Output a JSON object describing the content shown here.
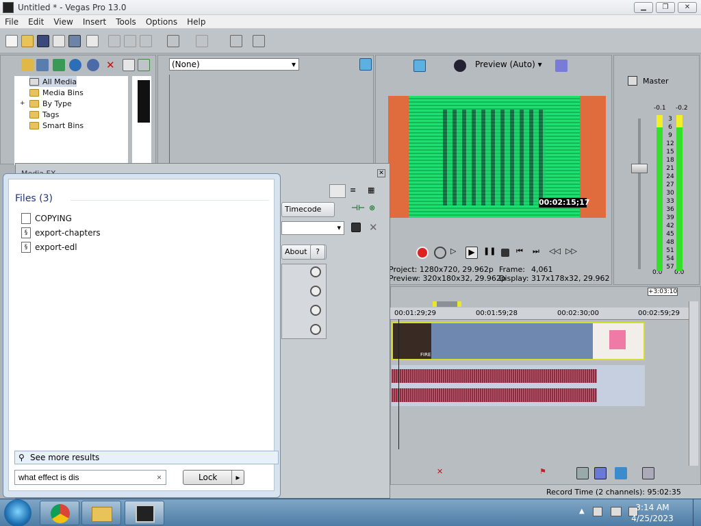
{
  "window": {
    "title": "Untitled * - Vegas Pro 13.0"
  },
  "menu": [
    "File",
    "Edit",
    "View",
    "Insert",
    "Tools",
    "Options",
    "Help"
  ],
  "explorer": {
    "items": [
      "All Media",
      "Media Bins",
      "By Type",
      "Tags",
      "Smart Bins"
    ]
  },
  "transitions_dropdown": {
    "value": "(None)"
  },
  "preview": {
    "mode": "Preview (Auto)",
    "timecode": "00:02:15;17",
    "project_label": "Project:",
    "project_value": "1280x720, 29.962p",
    "preview_label": "Preview:",
    "preview_value": "320x180x32, 29.962p",
    "frame_label": "Frame:",
    "frame_value": "4,061",
    "display_label": "Display:",
    "display_value": "317x178x32, 29.962"
  },
  "mixer": {
    "title": "Master",
    "peak_left": "-0.1",
    "peak_right": "-0.2",
    "scale": [
      "3",
      "6",
      "9",
      "12",
      "15",
      "18",
      "21",
      "24",
      "27",
      "30",
      "33",
      "36",
      "39",
      "42",
      "45",
      "48",
      "51",
      "54",
      "57"
    ],
    "bottom_left": "0.0",
    "bottom_right": "0.0"
  },
  "timeline": {
    "end_marker": "+3:03:10",
    "ruler": [
      "00:01:29;29",
      "00:01:59;28",
      "00:02:30;00",
      "00:02:59;29"
    ],
    "clip_text": "FIRE"
  },
  "fx_dialog": {
    "title": "Media FX",
    "timecode_button": "Timecode",
    "about_button": "About",
    "help_button": "?"
  },
  "start_menu": {
    "files_header": "Files (3)",
    "files": [
      "COPYING",
      "export-chapters",
      "export-edl"
    ],
    "see_more": "See more results",
    "search_value": "what effect is dis",
    "lock_label": "Lock"
  },
  "status": {
    "record_time": "Record Time (2 channels): 95:02:35"
  },
  "clock": {
    "time": "3:14 AM",
    "date": "4/25/2023"
  }
}
